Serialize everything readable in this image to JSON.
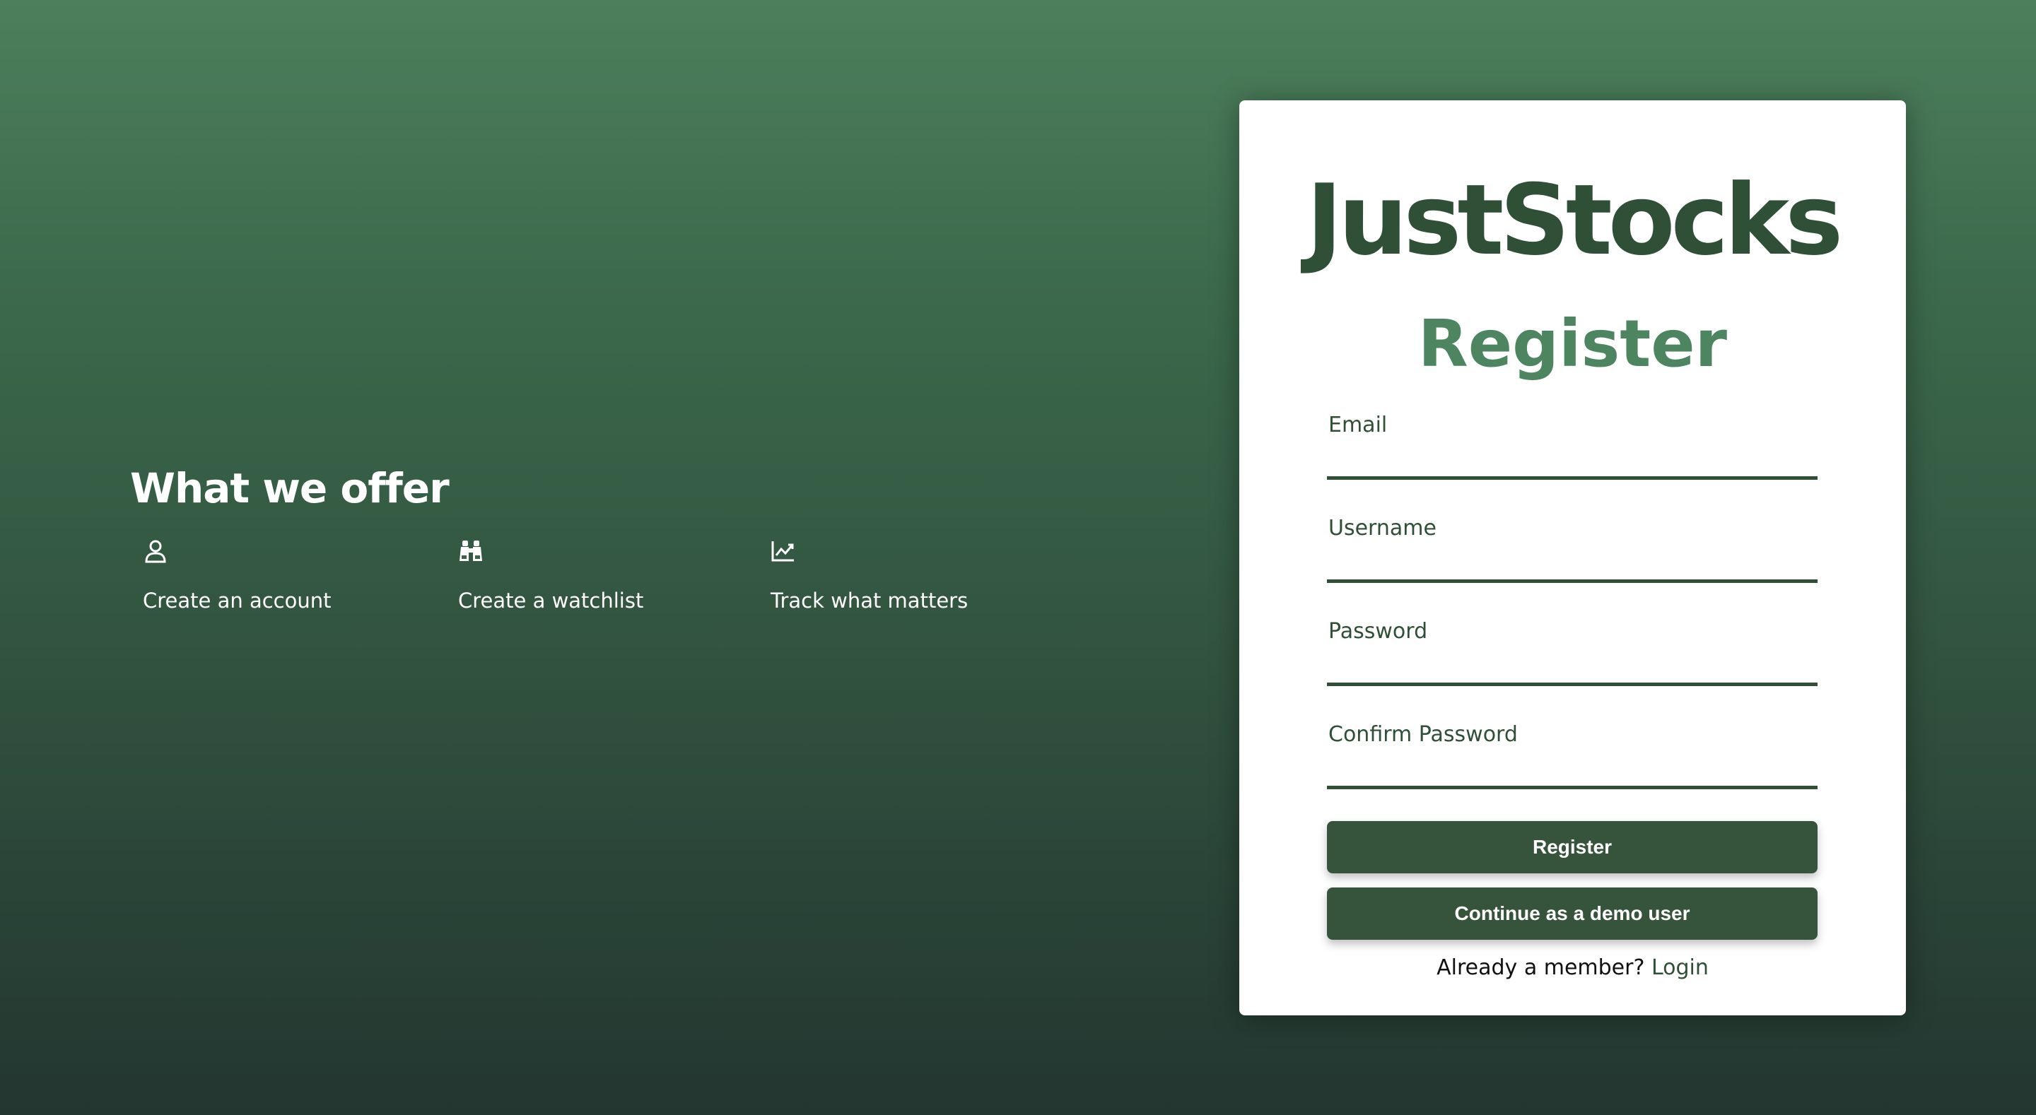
{
  "offer": {
    "title": "What we offer",
    "items": [
      {
        "icon": "user-icon",
        "label": "Create an account"
      },
      {
        "icon": "binoculars-icon",
        "label": "Create a watchlist"
      },
      {
        "icon": "line-chart-icon",
        "label": "Track what matters"
      }
    ]
  },
  "card": {
    "brand": "JustStocks",
    "title": "Register",
    "fields": {
      "email": {
        "label": "Email",
        "value": ""
      },
      "username": {
        "label": "Username",
        "value": ""
      },
      "password": {
        "label": "Password",
        "value": ""
      },
      "confirm_password": {
        "label": "Confirm Password",
        "value": ""
      }
    },
    "register_button": "Register",
    "demo_button": "Continue as a demo user",
    "footer_text": "Already a member?",
    "login_link": "Login"
  },
  "colors": {
    "brand_dark_green": "#2f4f37",
    "accent_green": "#4c8560",
    "button_green": "#36543b",
    "background_top": "#4d7f5c",
    "background_bottom": "#233630"
  }
}
